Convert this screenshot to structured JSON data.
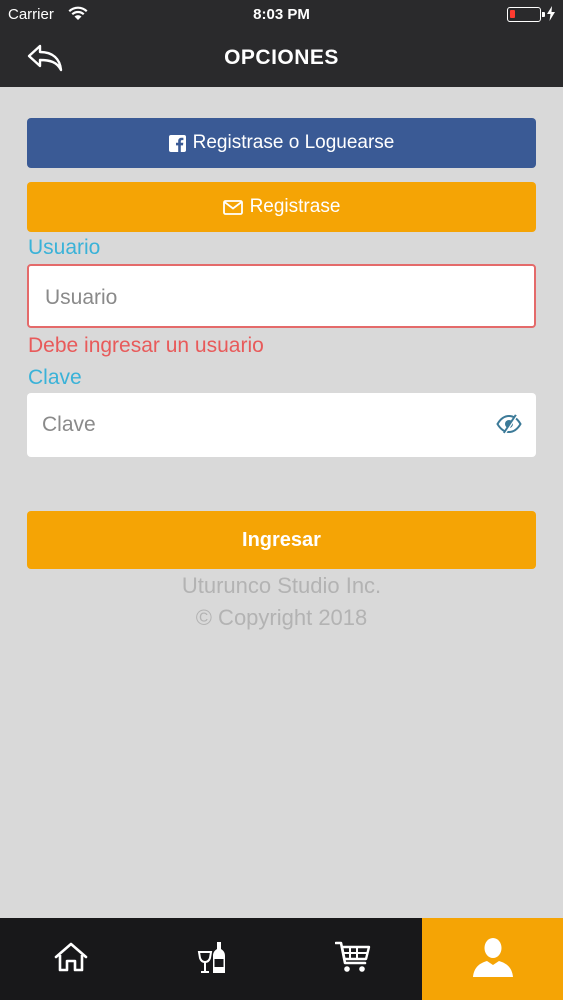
{
  "status": {
    "carrier": "Carrier",
    "time": "8:03 PM"
  },
  "header": {
    "title": "OPCIONES",
    "back_icon": "back-arrow-icon"
  },
  "buttons": {
    "facebook": "Registrase o Loguearse",
    "register": "Registrase",
    "login": "Ingresar"
  },
  "form": {
    "user_label": "Usuario",
    "user_placeholder": "Usuario",
    "user_error": "Debe ingresar un usuario",
    "pass_label": "Clave",
    "pass_placeholder": "Clave"
  },
  "footer": {
    "company": "Uturunco Studio Inc.",
    "copyright": "© Copyright 2018"
  },
  "tabs": [
    {
      "name": "home",
      "icon": "home-icon"
    },
    {
      "name": "drinks",
      "icon": "wine-bottle-icon"
    },
    {
      "name": "cart",
      "icon": "cart-icon"
    },
    {
      "name": "user",
      "icon": "user-icon",
      "active": true
    }
  ],
  "colors": {
    "header_bg": "#2a2a2c",
    "page_bg": "#d9d9d9",
    "facebook_blue": "#3a5a95",
    "accent_orange": "#f5a405",
    "label_blue": "#3ab2d8",
    "error_red": "#e85a5a"
  }
}
